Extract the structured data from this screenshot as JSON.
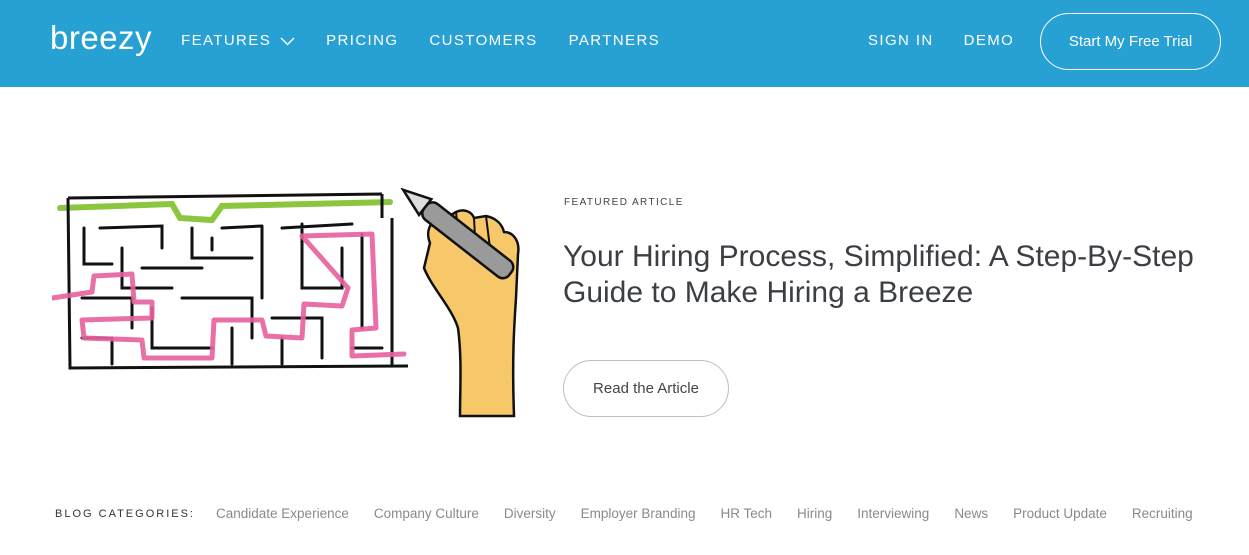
{
  "header": {
    "logo": "breezy",
    "nav": [
      {
        "label": "FEATURES",
        "has_dropdown": true
      },
      {
        "label": "PRICING"
      },
      {
        "label": "CUSTOMERS"
      },
      {
        "label": "PARTNERS"
      }
    ],
    "sign_in": "SIGN IN",
    "demo": "DEMO",
    "cta": "Start My Free Trial",
    "bg_color": "#27a0d4"
  },
  "hero": {
    "kicker": "FEATURED ARTICLE",
    "title": "Your Hiring Process, Simplified: A Step-By-Step Guide to Make Hiring a Breeze",
    "button": "Read the Article",
    "illustration": "maze-with-hand-drawing-icon"
  },
  "categories": {
    "label": "BLOG CATEGORIES:",
    "items": [
      "Candidate Experience",
      "Company Culture",
      "Diversity",
      "Employer Branding",
      "HR Tech",
      "Hiring",
      "Interviewing",
      "News",
      "Product Update",
      "Recruiting"
    ]
  }
}
